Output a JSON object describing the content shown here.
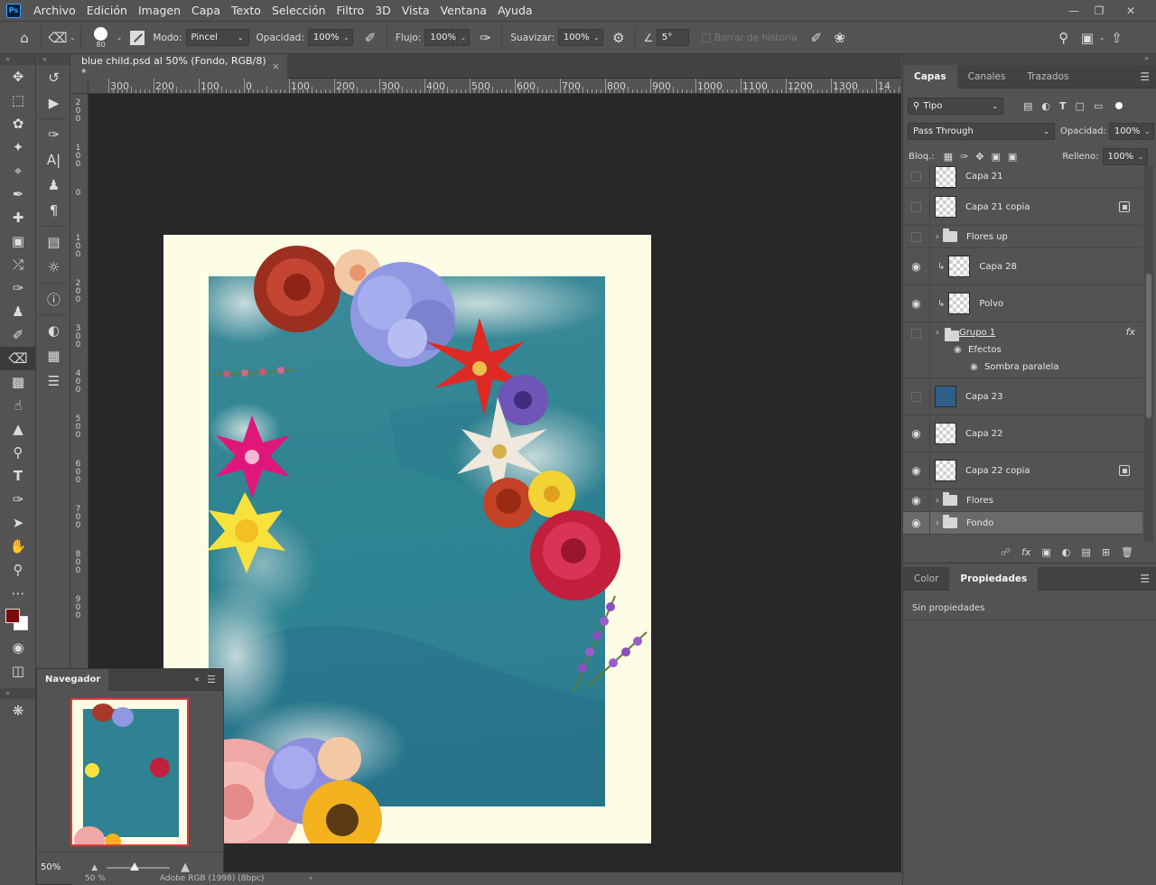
{
  "app": {
    "logo": "Ps"
  },
  "menu": [
    "Archivo",
    "Edición",
    "Imagen",
    "Capa",
    "Texto",
    "Selección",
    "Filtro",
    "3D",
    "Vista",
    "Ventana",
    "Ayuda"
  ],
  "options": {
    "brush_size": "80",
    "mode_label": "Modo:",
    "mode_value": "Pincel",
    "opacity_label": "Opacidad:",
    "opacity_value": "100%",
    "flow_label": "Flujo:",
    "flow_value": "100%",
    "smooth_label": "Suavizar:",
    "smooth_value": "100%",
    "angle_value": "5°",
    "history_label": "Borrar de historia"
  },
  "document": {
    "tab_title": "blue child.psd al 50% (Fondo, RGB/8) *",
    "close": "×",
    "ruler_h": [
      "300",
      "200",
      "100",
      "0",
      "100",
      "200",
      "300",
      "400",
      "500",
      "600",
      "700",
      "800",
      "900",
      "1000",
      "1100",
      "1200",
      "1300",
      "14"
    ],
    "ruler_v": [
      "2\n0\n0",
      "1\n0\n0",
      "0",
      "1\n0\n0",
      "2\n0\n0",
      "3\n0\n0",
      "4\n0\n0",
      "5\n0\n0",
      "6\n0\n0",
      "7\n0\n0",
      "8\n0\n0",
      "9\n0\n0"
    ]
  },
  "navigator": {
    "tab": "Navegador",
    "zoom": "50%"
  },
  "status": {
    "zoom": "50 %",
    "profile": "Adobe RGB (1998) (8bpc)"
  },
  "layers_panel": {
    "tabs": [
      "Capas",
      "Canales",
      "Trazados"
    ],
    "filter_kind": "Tipo",
    "blend_mode": "Pass Through",
    "opacity_label": "Opacidad:",
    "opacity_value": "100%",
    "lock_label": "Bloq.:",
    "fill_label": "Relleno:",
    "fill_value": "100%",
    "layers": [
      {
        "name": "Capa 21",
        "visible": false,
        "kind": "pixel"
      },
      {
        "name": "Capa 21 copia",
        "visible": false,
        "kind": "smart"
      },
      {
        "name": "Flores up",
        "visible": false,
        "kind": "group"
      },
      {
        "name": "Capa 28",
        "visible": true,
        "kind": "clipped"
      },
      {
        "name": "Polvo",
        "visible": true,
        "kind": "clipped"
      },
      {
        "name": "Grupo 1",
        "visible": false,
        "kind": "group-fx"
      },
      {
        "name": "Efectos",
        "visible": true,
        "kind": "effects"
      },
      {
        "name": "Sombra paralela",
        "visible": true,
        "kind": "effect"
      },
      {
        "name": "Capa 23",
        "visible": false,
        "kind": "image"
      },
      {
        "name": "Capa 22",
        "visible": true,
        "kind": "image"
      },
      {
        "name": "Capa 22 copia",
        "visible": true,
        "kind": "smart"
      },
      {
        "name": "Flores",
        "visible": true,
        "kind": "group"
      },
      {
        "name": "Fondo",
        "visible": true,
        "kind": "group-selected"
      }
    ],
    "fx": "fx"
  },
  "properties_panel": {
    "tabs": [
      "Color",
      "Propiedades"
    ],
    "empty_text": "Sin propiedades"
  },
  "colors": {
    "foreground": "#7a0c0c",
    "background": "#ffffff",
    "teal": "#2e8291",
    "paper": "#fdfde6"
  }
}
